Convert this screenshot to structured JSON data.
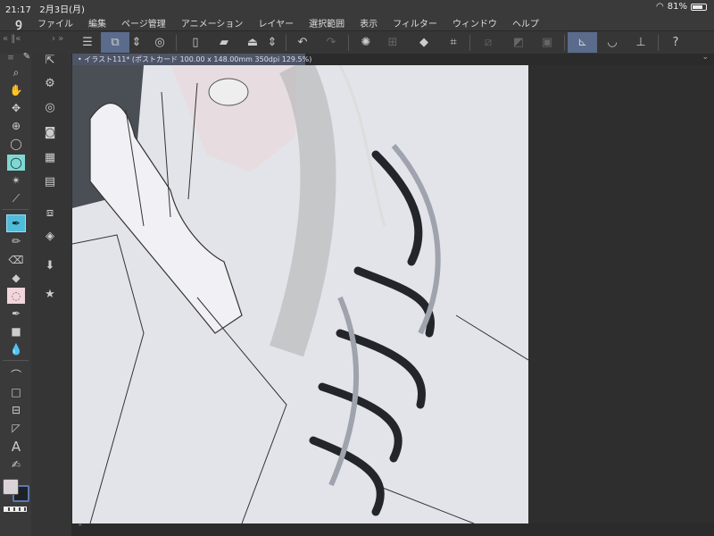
{
  "status": {
    "time": "21:17",
    "date": "2月3日(月)",
    "battery": "81%",
    "battery_level": 0.81
  },
  "menu": {
    "logo": "ꝯ",
    "items": [
      "ファイル",
      "編集",
      "ページ管理",
      "アニメーション",
      "レイヤー",
      "選択範囲",
      "表示",
      "フィルター",
      "ウィンドウ",
      "ヘルプ"
    ]
  },
  "toolbar": {
    "collapse_left": "« ‖«",
    "collapse_right": "› »"
  },
  "document": {
    "tab_title": "イラスト111* (ポストカード 100.00 x 148.00mm 350dpi 129.5%)"
  },
  "tools": {
    "text_tool": "A"
  },
  "colors": {
    "main": "#d9d3d8",
    "sub": "#1e2226",
    "accent": "#5a6b8c"
  }
}
